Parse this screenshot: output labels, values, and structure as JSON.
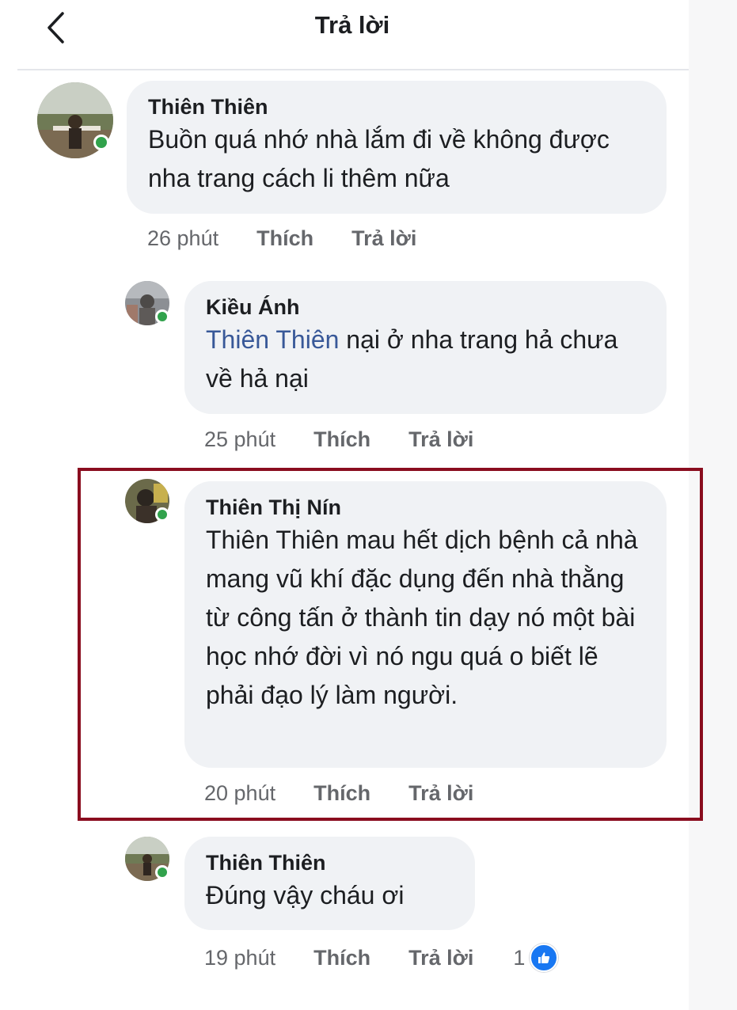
{
  "header": {
    "title": "Trả lời",
    "back_icon": "chevron-left-icon"
  },
  "comments": [
    {
      "author": "Thiên Thiên",
      "text": "Buồn quá nhớ nhà lắm đi về không được nha trang cách li thêm nữa",
      "time": "26 phút",
      "like": "Thích",
      "reply": "Trả lời"
    },
    {
      "author": "Kiều Ánh",
      "mention": "Thiên Thiên",
      "text": " nại ở nha trang hả chưa về hả nại",
      "time": "25 phút",
      "like": "Thích",
      "reply": "Trả lời"
    },
    {
      "author": "Thiên Thị Nín",
      "text": "Thiên Thiên mau hết dịch bệnh cả nhà mang vũ khí đặc dụng đến nhà thằng từ công tấn ở thành tin dạy nó một bài học nhớ đời vì nó ngu quá o biết lẽ phải đạo lý làm người.",
      "time": "20 phút",
      "like": "Thích",
      "reply": "Trả lời"
    },
    {
      "author": "Thiên Thiên",
      "text": "Đúng vậy cháu ơi",
      "time": "19 phút",
      "like": "Thích",
      "reply": "Trả lời",
      "reaction_count": "1",
      "reaction_icon": "thumbs-up-icon"
    }
  ],
  "colors": {
    "bubble": "#f0f2f5",
    "mention": "#385898",
    "online": "#31a24c",
    "highlight": "#8a0d1f",
    "like_blue": "#1877f2"
  }
}
